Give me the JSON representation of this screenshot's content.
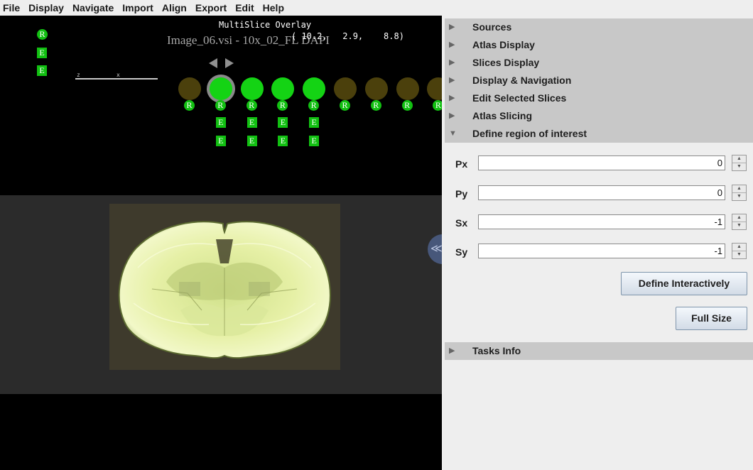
{
  "menu": [
    "File",
    "Display",
    "Navigate",
    "Import",
    "Align",
    "Export",
    "Edit",
    "Help"
  ],
  "viewer": {
    "overlay_title": "MultiSlice Overlay",
    "image_name": "Image_06.vsi - 10x_02_FL DAPI",
    "coordinates": "( 10.2,   2.9,    8.8)",
    "re_label": "R",
    "e_label": "E",
    "scale_labels": [
      "z",
      "x"
    ]
  },
  "slices": [
    {
      "state": "inactive",
      "has_e": false
    },
    {
      "state": "current",
      "has_e": true
    },
    {
      "state": "active",
      "has_e": true
    },
    {
      "state": "active",
      "has_e": true
    },
    {
      "state": "active",
      "has_e": true
    },
    {
      "state": "inactive",
      "has_e": false
    },
    {
      "state": "inactive",
      "has_e": false
    },
    {
      "state": "inactive",
      "has_e": false
    },
    {
      "state": "inactive",
      "has_e": false
    }
  ],
  "colors": {
    "active_slice": "#14d314",
    "inactive_slice": "#4b400c",
    "brain_tint": "#e8f2a8"
  },
  "panel": {
    "sections": [
      {
        "label": "Sources",
        "expanded": false
      },
      {
        "label": "Atlas Display",
        "expanded": false
      },
      {
        "label": "Slices Display",
        "expanded": false
      },
      {
        "label": "Display & Navigation",
        "expanded": false
      },
      {
        "label": "Edit Selected Slices",
        "expanded": false
      },
      {
        "label": "Atlas Slicing",
        "expanded": false
      },
      {
        "label": "Define region of interest",
        "expanded": true
      }
    ],
    "roi": {
      "fields": [
        {
          "label": "Px",
          "value": "0"
        },
        {
          "label": "Py",
          "value": "0"
        },
        {
          "label": "Sx",
          "value": "-1"
        },
        {
          "label": "Sy",
          "value": "-1"
        }
      ],
      "define_interactively_label": "Define Interactively",
      "full_size_label": "Full Size"
    },
    "tasks_info_label": "Tasks Info"
  }
}
